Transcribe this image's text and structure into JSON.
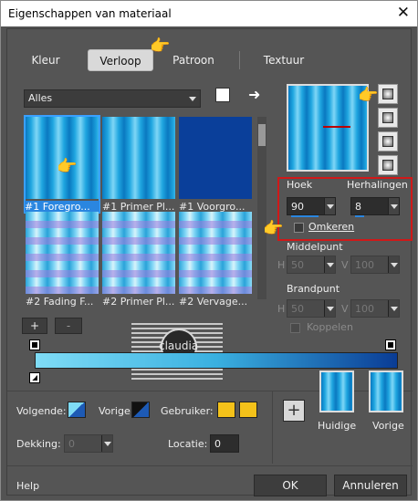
{
  "window": {
    "title": "Eigenschappen van materiaal",
    "close_glyph": "✕"
  },
  "tabs": [
    {
      "label": "Kleur"
    },
    {
      "label": "Verloop"
    },
    {
      "label": "Patroon"
    },
    {
      "label": "Textuur"
    }
  ],
  "filter": {
    "selected": "Alles"
  },
  "gallery": [
    {
      "label": "#1 Foregro..."
    },
    {
      "label": "#1 Primer Pl..."
    },
    {
      "label": "#1 Voorgro..."
    },
    {
      "label": "#2 Fading F..."
    },
    {
      "label": "#2 Primer Pl..."
    },
    {
      "label": "#2 Vervage..."
    }
  ],
  "small_buttons": {
    "add": "+",
    "remove": "-"
  },
  "params": {
    "angle_label": "Hoek",
    "angle_value": "90",
    "repeats_label": "Herhalingen",
    "repeats_value": "8",
    "invert_label": "Omkeren",
    "center_label": "Middelpunt",
    "center_h_label": "H",
    "center_h_value": "50",
    "center_v_label": "V",
    "center_v_value": "100",
    "focus_label": "Brandpunt",
    "focus_h_label": "H",
    "focus_h_value": "50",
    "focus_v_label": "V",
    "focus_v_value": "100",
    "link_label": "Koppelen"
  },
  "bottom": {
    "next_label": "Volgende:",
    "prev_label": "Vorige:",
    "user_label": "Gebruiker:",
    "opacity_label": "Dekking:",
    "opacity_value": "0",
    "location_label": "Locatie:",
    "location_value": "0",
    "current_label": "Huidige",
    "previous_label": "Vorige",
    "plus": "+"
  },
  "footer": {
    "help": "Help",
    "ok": "OK",
    "cancel": "Annuleren"
  },
  "watermark": "claudia",
  "colors": {
    "accent": "#2a86e0",
    "redbox": "#d01818",
    "user_yellow": "#f4c21a",
    "grad_start": "#7fdcf6",
    "grad_end": "#0a3c95"
  }
}
